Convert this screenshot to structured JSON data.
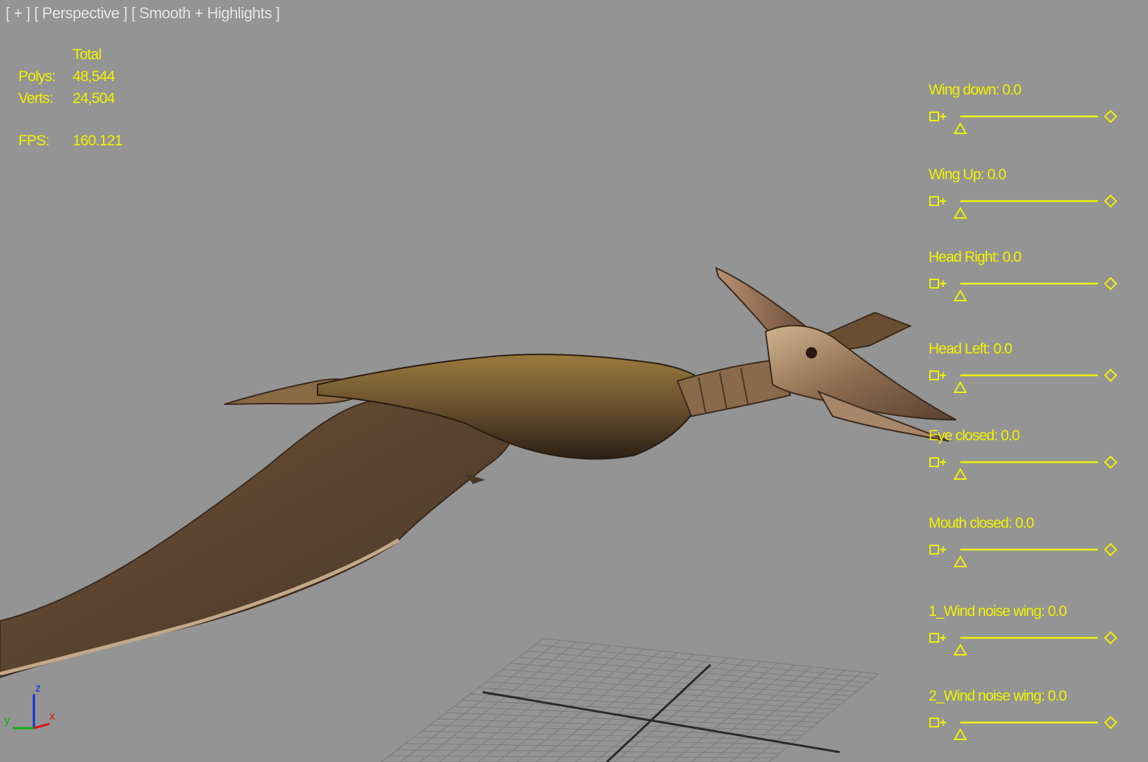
{
  "viewport": {
    "label_menu": "[ + ]",
    "label_view": "[ Perspective ]",
    "label_shading": "[ Smooth + Highlights ]"
  },
  "stats": {
    "header": "Total",
    "polys_label": "Polys:",
    "polys_value": "48,544",
    "verts_label": "Verts:",
    "verts_value": "24,504",
    "fps_label": "FPS:",
    "fps_value": "160.121"
  },
  "morph_sliders": [
    {
      "label": "Wing down: 0.0",
      "value": 0.0
    },
    {
      "label": "Wing Up: 0.0",
      "value": 0.0
    },
    {
      "label": "Head Right: 0.0",
      "value": 0.0
    },
    {
      "label": "Head Left: 0.0",
      "value": 0.0
    },
    {
      "label": "Eye closed: 0.0",
      "value": 0.0
    },
    {
      "label": "Mouth closed: 0.0",
      "value": 0.0
    },
    {
      "label": "1_Wind noise wing: 0.0",
      "value": 0.0
    },
    {
      "label": "2_Wind noise wing: 0.0",
      "value": 0.0
    }
  ],
  "axis_gizmo": {
    "x": "x",
    "y": "y",
    "z": "z"
  },
  "colors": {
    "background": "#949494",
    "overlay_text": "#f2f200",
    "label_text": "#e8e8e8",
    "grid": "#7e7e7e",
    "axis_x": "#e01010",
    "axis_y": "#10b010",
    "axis_z": "#1030e0"
  },
  "icons": [
    "slider-key-icon",
    "slider-thumb-icon",
    "slider-end-diamond-icon",
    "axis-gizmo-icon"
  ]
}
